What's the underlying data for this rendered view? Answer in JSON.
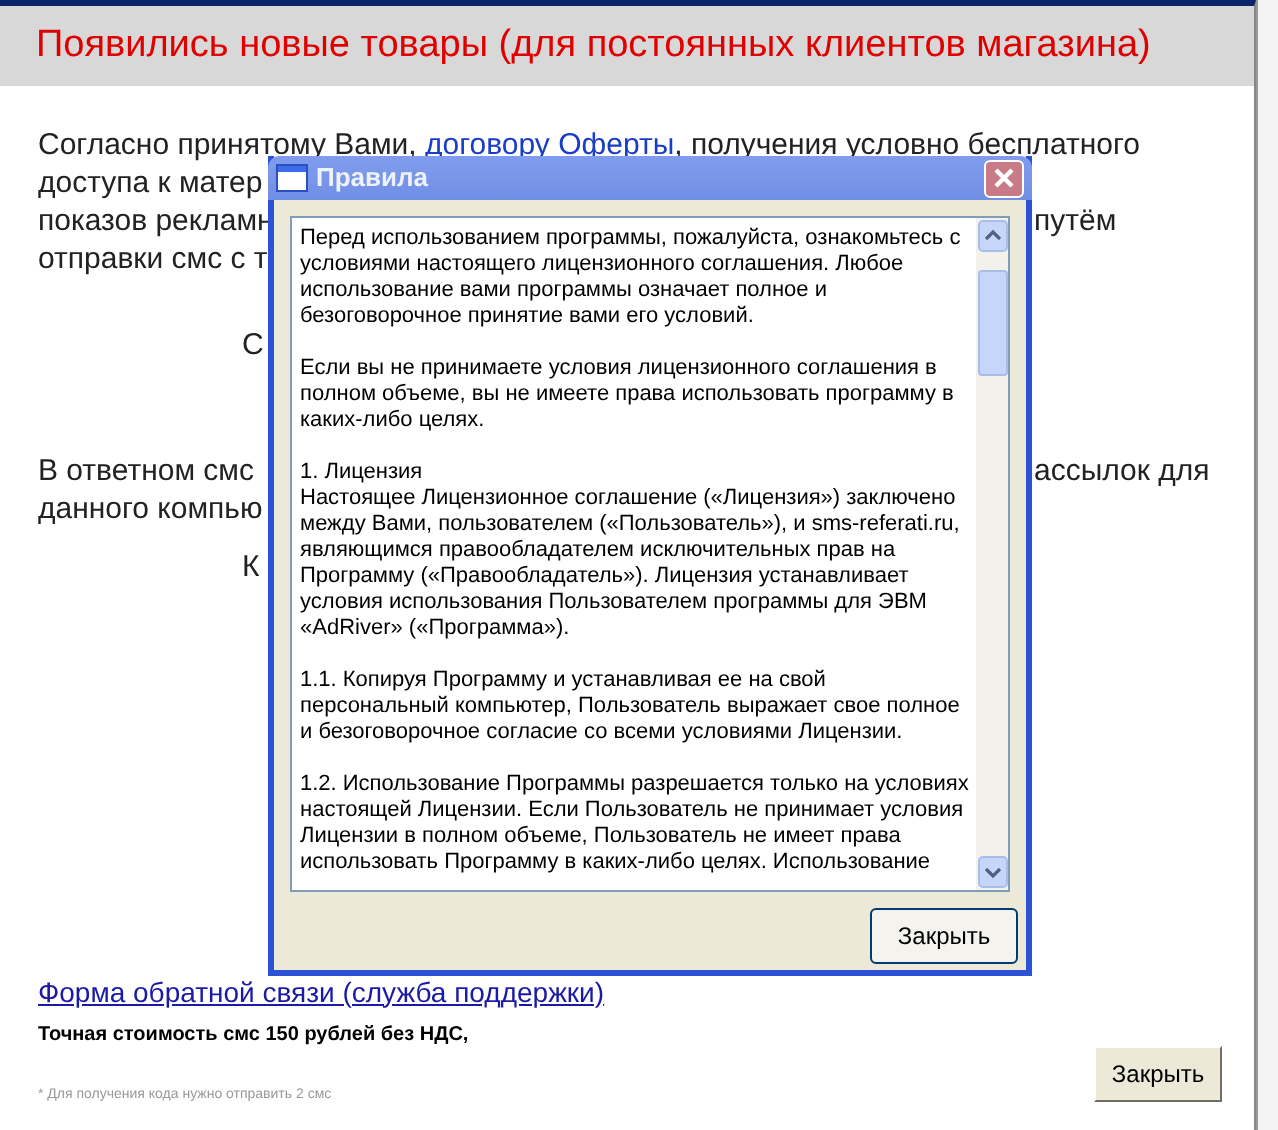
{
  "page": {
    "title": "Появились новые товары (для постоянных клиентов магазина)",
    "intro": {
      "before": "Согласно принятому Вами, ",
      "link": "договору Оферты",
      "after": ", получения условно бесплатного"
    },
    "paragraphs": [
      {
        "lines": [
          {
            "left": "доступа к матер"
          },
          {
            "left": "показов рекламн",
            "right": "путём"
          },
          {
            "left": "отправки смс с т"
          }
        ]
      },
      {
        "lines": [
          {
            "left": "С"
          }
        ],
        "kind": "indented"
      },
      {
        "lines": [
          {
            "left": "В ответном смс",
            "right": "ассылок для"
          },
          {
            "left": "данного компью"
          }
        ]
      },
      {
        "lines": [
          {
            "left": "К"
          }
        ],
        "kind": "indented"
      }
    ],
    "support_link": "Форма обратной связи (служба поддержки)",
    "price_note": "Точная стоимость смс 150 рублей без НДС,",
    "footnote": "* Для получения кода нужно отправить 2 смс",
    "close_button": "Закрыть"
  },
  "dialog": {
    "title": "Правила",
    "close_button": "Закрыть",
    "paragraphs": [
      [
        "Перед использованием программы, пожалуйста, ознакомьтесь с",
        "условиями настоящего лицензионного соглашения. Любое",
        "использование вами программы означает полное и",
        "безоговорочное принятие вами его условий."
      ],
      [
        "Если вы не принимаете условия лицензионного соглашения в",
        "полном объеме, вы не имеете права использовать программу в",
        "каких-либо целях."
      ],
      [
        "1. Лицензия",
        "Настоящее Лицензионное соглашение («Лицензия») заключено",
        "между Вами, пользователем («Пользователь»), и sms-referati.ru,",
        "являющимся правообладателем исключительных прав на",
        "Программу («Правообладатель»). Лицензия устанавливает",
        "условия использования Пользователем программы для ЭВМ",
        "«AdRiver» («Программа»)."
      ],
      [
        "1.1. Копируя Программу и устанавливая ее на свой",
        "персональный компьютер, Пользователь выражает свое полное",
        "и безоговорочное согласие со всеми условиями Лицензии."
      ],
      [
        "1.2. Использование Программы разрешается только на условиях",
        "настоящей Лицензии. Если Пользователь не принимает условия",
        "Лицензии в полном объеме, Пользователь не имеет права",
        "использовать Программу в каких-либо целях. Использование"
      ]
    ]
  }
}
